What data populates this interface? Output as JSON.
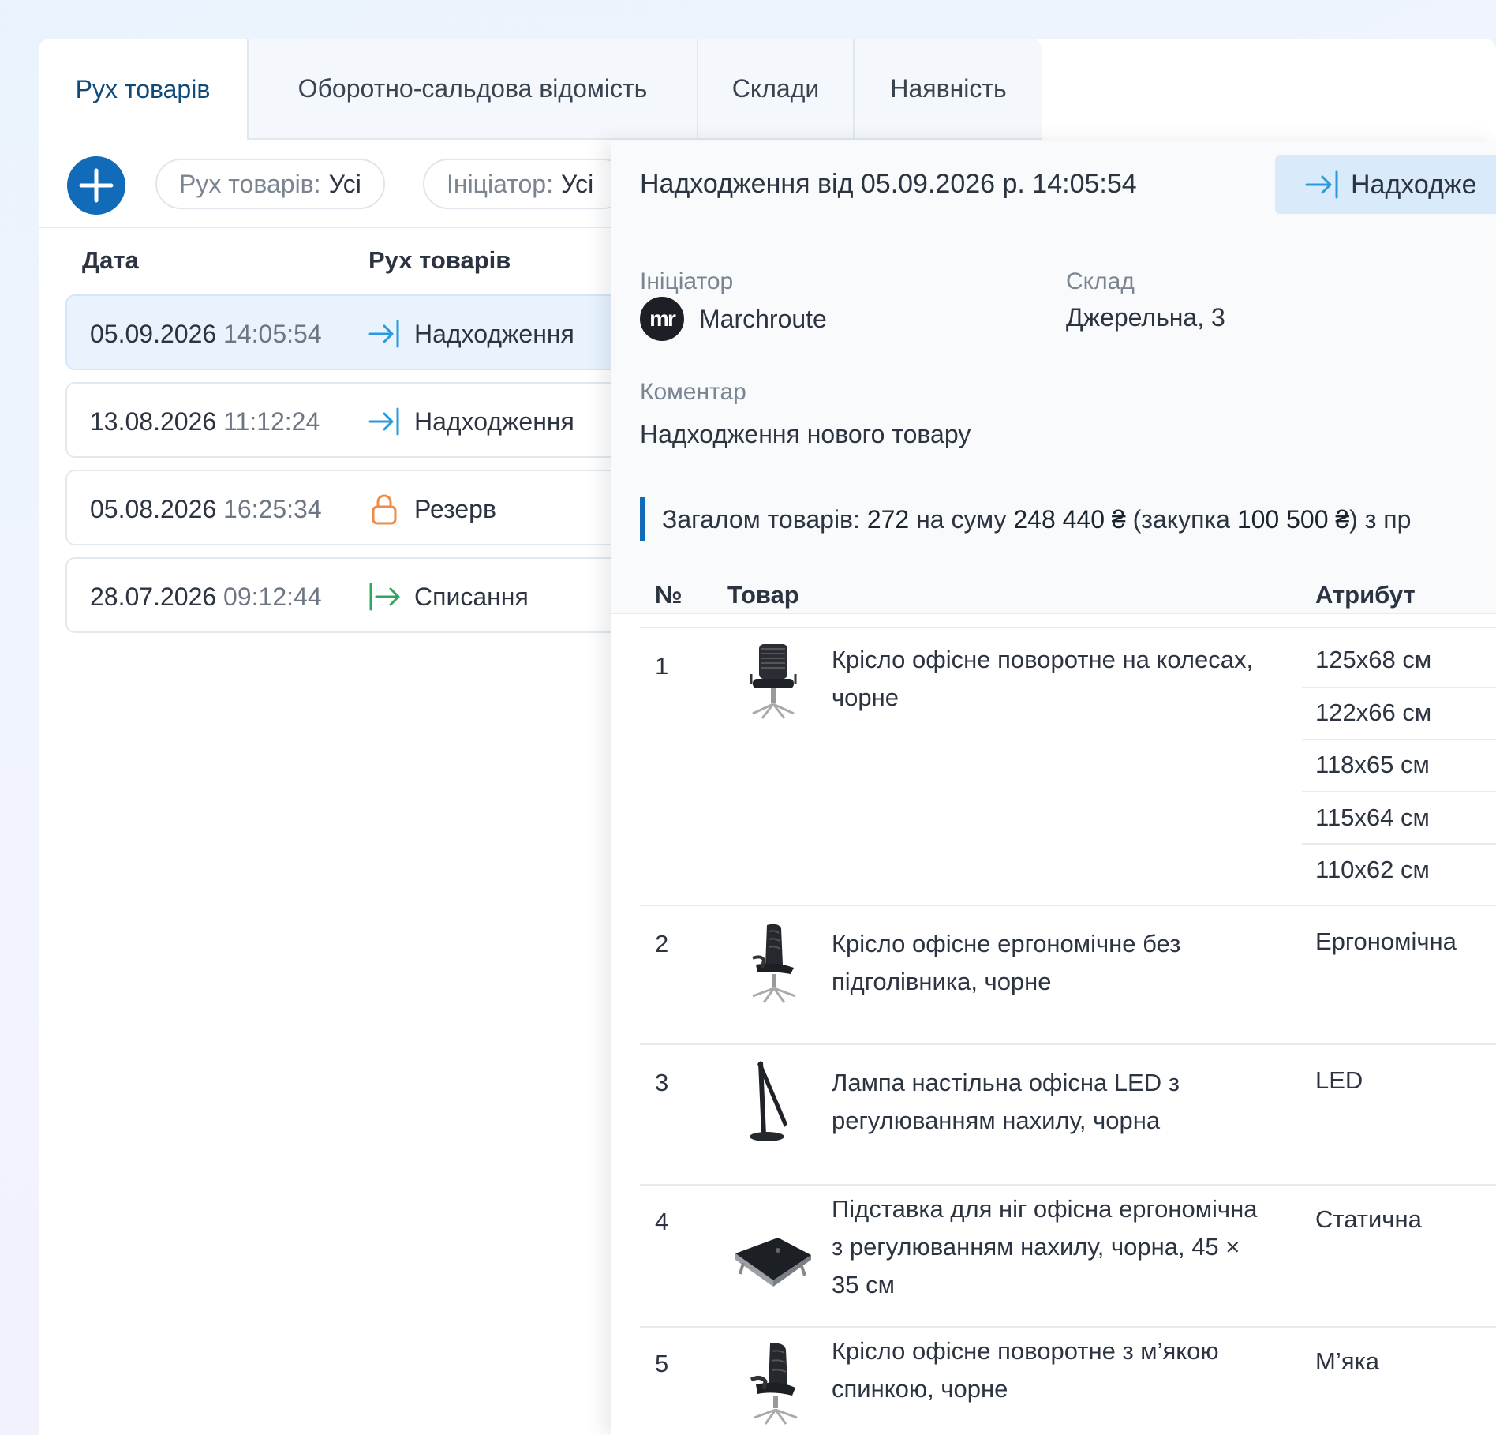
{
  "tabs": [
    "Рух товарів",
    "Оборотно-сальдова відомість",
    "Склади",
    "Наявність"
  ],
  "filters": {
    "movement": {
      "label": "Рух товарів:",
      "value": "Усі"
    },
    "initiator": {
      "label": "Ініціатор:",
      "value": "Усі"
    }
  },
  "list": {
    "columns": {
      "date": "Дата",
      "movement": "Рух товарів"
    },
    "rows": [
      {
        "date": "05.09.2026",
        "time": "14:05:54",
        "type": "Надходження",
        "icon": "arrow-in-icon"
      },
      {
        "date": "13.08.2026",
        "time": "11:12:24",
        "type": "Надходження",
        "icon": "arrow-in-icon"
      },
      {
        "date": "05.08.2026",
        "time": "16:25:34",
        "type": "Резерв",
        "icon": "lock-icon"
      },
      {
        "date": "28.07.2026",
        "time": "09:12:44",
        "type": "Списання",
        "icon": "arrow-out-icon"
      }
    ]
  },
  "detail": {
    "title": "Надходження від 05.09.2026 р. 14:05:54",
    "type_button": "Надходже",
    "initiator_label": "Ініціатор",
    "initiator_avatar": "mr",
    "initiator": "Marchroute",
    "warehouse_label": "Склад",
    "warehouse": "Джерельна, 3",
    "comment_label": "Коментар",
    "comment": "Надходження нового товару",
    "summary": {
      "prefix": "Загалом товарів:",
      "count": "272",
      "mid": "на суму",
      "sum": "248 440 ₴",
      "purchase_prefix": "(закупка",
      "purchase": "100 500 ₴",
      "suffix": ") з пр"
    },
    "table": {
      "headers": {
        "num": "№",
        "product": "Товар",
        "attribute": "Атрибут"
      },
      "items": [
        {
          "num": "1",
          "name": "Крісло офісне поворотне на колесах, чорне",
          "attributes": [
            "125x68 см",
            "122x66 см",
            "118x65 см",
            "115x64 см",
            "110x62 см"
          ]
        },
        {
          "num": "2",
          "name": "Крісло офісне ергономічне без підголівника, чорне",
          "attributes": [
            "Ергономічна"
          ]
        },
        {
          "num": "3",
          "name": "Лампа настільна офісна LED з регулюванням нахилу, чорна",
          "attributes": [
            "LED"
          ]
        },
        {
          "num": "4",
          "name": "Підставка для ніг офісна ергономічна з регулюванням нахилу, чорна, 45 × 35 см",
          "attributes": [
            "Статична"
          ]
        },
        {
          "num": "5",
          "name": "Крісло офісне поворотне з м’якою спинкою, чорне",
          "attributes": [
            "М’яка"
          ]
        }
      ]
    }
  }
}
